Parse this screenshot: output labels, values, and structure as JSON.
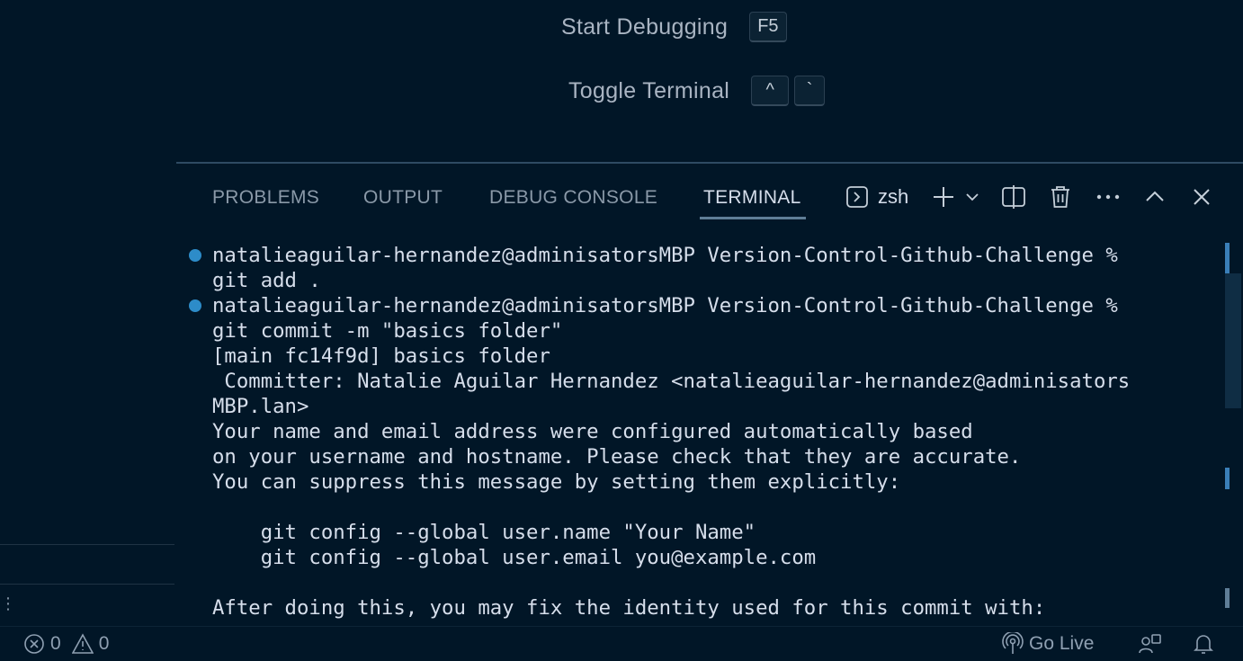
{
  "welcome": {
    "shortcuts": [
      {
        "label": "Start Debugging",
        "keys": [
          "F5"
        ]
      },
      {
        "label": "Toggle Terminal",
        "keys": [
          "^",
          "`"
        ]
      }
    ]
  },
  "panel": {
    "tabs": [
      "PROBLEMS",
      "OUTPUT",
      "DEBUG CONSOLE",
      "TERMINAL"
    ],
    "active_tab": "TERMINAL",
    "shell": "zsh",
    "icons": [
      "terminal-icon",
      "plus-icon",
      "chevron-down-icon",
      "split-icon",
      "trash-icon",
      "ellipsis-icon",
      "chevron-up-icon",
      "close-icon"
    ]
  },
  "terminal": {
    "lines": [
      "natalieaguilar-hernandez@adminisatorsMBP Version-Control-Github-Challenge %",
      "git add .",
      "natalieaguilar-hernandez@adminisatorsMBP Version-Control-Github-Challenge %",
      "git commit -m \"basics folder\"",
      "[main fc14f9d] basics folder",
      " Committer: Natalie Aguilar Hernandez <natalieaguilar-hernandez@adminisators",
      "MBP.lan>",
      "Your name and email address were configured automatically based",
      "on your username and hostname. Please check that they are accurate.",
      "You can suppress this message by setting them explicitly:",
      "",
      "    git config --global user.name \"Your Name\"",
      "    git config --global user.email you@example.com",
      "",
      "After doing this, you may fix the identity used for this commit with:"
    ]
  },
  "status": {
    "errors": "0",
    "warnings": "0",
    "go_live": "Go Live"
  },
  "colors": {
    "background": "#011627",
    "text": "#d6deeb",
    "accent": "#2d8cc9"
  }
}
